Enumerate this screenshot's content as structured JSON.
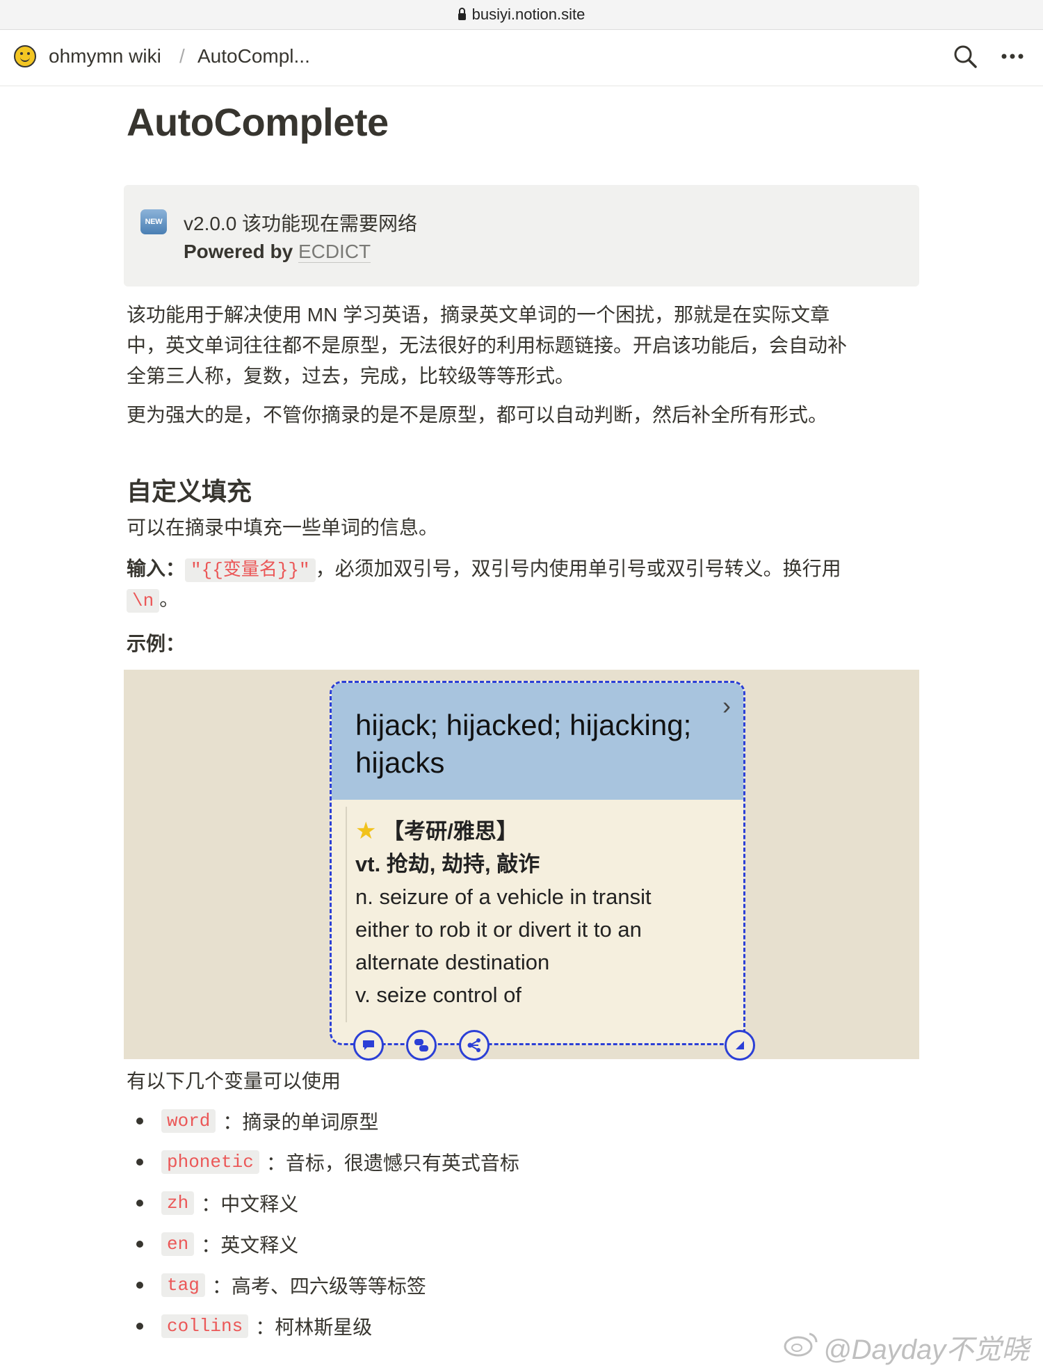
{
  "browser": {
    "url": "busiyi.notion.site"
  },
  "topbar": {
    "workspace": "ohmymn wiki",
    "separator": "/",
    "page": "AutoCompl..."
  },
  "title": "AutoComplete",
  "callout": {
    "icon": "new-badge-icon",
    "badge_text": "NEW",
    "line1": "v2.0.0 该功能现在需要网络",
    "line2_prefix": "Powered by ",
    "line2_link": "ECDICT"
  },
  "intro": {
    "p1_l1": "该功能用于解决使用 MN 学习英语，摘录英文单词的一个困扰，那就是在实际文章",
    "p1_l2": "中，英文单词往往都不是原型，无法很好的利用标题链接。开启该功能后，会自动补",
    "p1_l3": "全第三人称，复数，过去，完成，比较级等等形式。",
    "p2": "更为强大的是，不管你摘录的是不是原型，都可以自动判断，然后补全所有形式。"
  },
  "section": {
    "heading": "自定义填充",
    "desc": "可以在摘录中填充一些单词的信息。",
    "input_label": "输入：",
    "input_code": "\"{{变量名}}\"",
    "input_rest": "，必须加双引号，双引号内使用单引号或双引号转义。换行用",
    "newline_code": "\\n",
    "newline_end": "。",
    "example_label": "示例："
  },
  "example_card": {
    "title_l1": "hijack; hijacked; hijacking;",
    "title_l2": "hijacks",
    "tag_line": "【考研/雅思】",
    "zh": "vt. 抢劫, 劫持, 敲诈",
    "en_l1": "n. seizure of a vehicle in transit",
    "en_l2": "either to rob it or divert it to an",
    "en_l3": "alternate destination",
    "en_l4": "v. seize control of",
    "icons": [
      "comment-icon",
      "merge-icon",
      "share-icon",
      "resize-icon"
    ]
  },
  "vars_intro": "有以下几个变量可以使用",
  "variables": [
    {
      "code": "word",
      "sep": "：",
      "desc": "摘录的单词原型"
    },
    {
      "code": "phonetic",
      "sep": "：",
      "desc": "音标，很遗憾只有英式音标"
    },
    {
      "code": "zh",
      "sep": "：",
      "desc": "中文释义"
    },
    {
      "code": "en",
      "sep": "：",
      "desc": "英文释义"
    },
    {
      "code": "tag",
      "sep": "：",
      "desc": "高考、四六级等等标签"
    },
    {
      "code": "collins",
      "sep": "：",
      "desc": "柯林斯星级"
    }
  ],
  "watermark": "@Dayday不觉晓",
  "colors": {
    "code_text": "#eb5757",
    "card_border": "#2b3fd6",
    "card_head": "#a8c4de",
    "figure_bg": "#e7e0cf"
  }
}
